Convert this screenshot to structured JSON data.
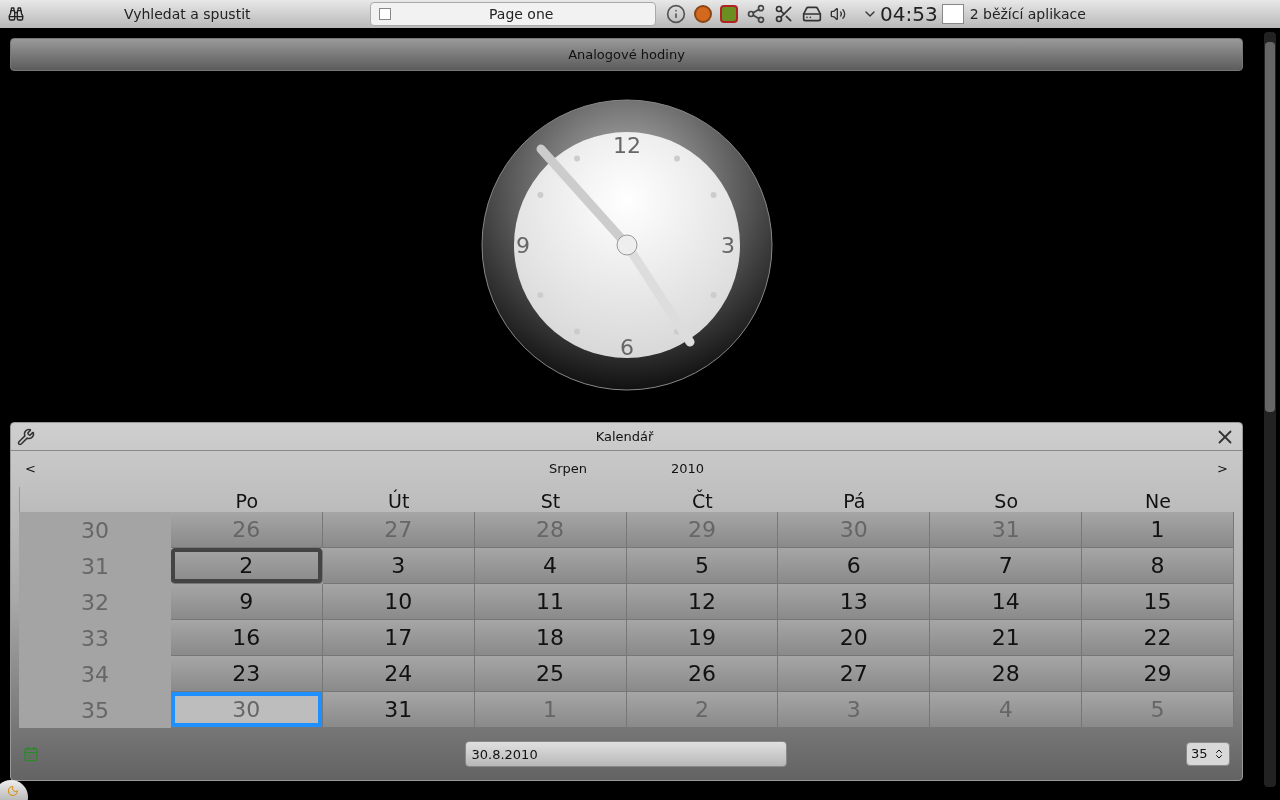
{
  "taskbar": {
    "launcher": "Vyhledat a spustit",
    "task": "Page one",
    "time": "04:53",
    "apps": "2 běžící aplikace"
  },
  "clock_widget": {
    "title": "Analogové hodiny",
    "numerals": [
      "12",
      "3",
      "6",
      "9"
    ]
  },
  "calendar": {
    "title": "Kalendář",
    "prev": "<",
    "next": ">",
    "month": "Srpen",
    "year": "2010",
    "weekdays": [
      "Po",
      "Út",
      "St",
      "Čt",
      "Pá",
      "So",
      "Ne"
    ],
    "weeks": [
      {
        "number": "30",
        "days": [
          {
            "label": "26",
            "outside": true,
            "today": false,
            "selected": false
          },
          {
            "label": "27",
            "outside": true,
            "today": false,
            "selected": false
          },
          {
            "label": "28",
            "outside": true,
            "today": false,
            "selected": false
          },
          {
            "label": "29",
            "outside": true,
            "today": false,
            "selected": false
          },
          {
            "label": "30",
            "outside": true,
            "today": false,
            "selected": false
          },
          {
            "label": "31",
            "outside": true,
            "today": false,
            "selected": false
          },
          {
            "label": "1",
            "outside": false,
            "today": false,
            "selected": false
          }
        ]
      },
      {
        "number": "31",
        "days": [
          {
            "label": "2",
            "outside": false,
            "today": true,
            "selected": false
          },
          {
            "label": "3",
            "outside": false,
            "today": false,
            "selected": false
          },
          {
            "label": "4",
            "outside": false,
            "today": false,
            "selected": false
          },
          {
            "label": "5",
            "outside": false,
            "today": false,
            "selected": false
          },
          {
            "label": "6",
            "outside": false,
            "today": false,
            "selected": false
          },
          {
            "label": "7",
            "outside": false,
            "today": false,
            "selected": false
          },
          {
            "label": "8",
            "outside": false,
            "today": false,
            "selected": false
          }
        ]
      },
      {
        "number": "32",
        "days": [
          {
            "label": "9",
            "outside": false,
            "today": false,
            "selected": false
          },
          {
            "label": "10",
            "outside": false,
            "today": false,
            "selected": false
          },
          {
            "label": "11",
            "outside": false,
            "today": false,
            "selected": false
          },
          {
            "label": "12",
            "outside": false,
            "today": false,
            "selected": false
          },
          {
            "label": "13",
            "outside": false,
            "today": false,
            "selected": false
          },
          {
            "label": "14",
            "outside": false,
            "today": false,
            "selected": false
          },
          {
            "label": "15",
            "outside": false,
            "today": false,
            "selected": false
          }
        ]
      },
      {
        "number": "33",
        "days": [
          {
            "label": "16",
            "outside": false,
            "today": false,
            "selected": false
          },
          {
            "label": "17",
            "outside": false,
            "today": false,
            "selected": false
          },
          {
            "label": "18",
            "outside": false,
            "today": false,
            "selected": false
          },
          {
            "label": "19",
            "outside": false,
            "today": false,
            "selected": false
          },
          {
            "label": "20",
            "outside": false,
            "today": false,
            "selected": false
          },
          {
            "label": "21",
            "outside": false,
            "today": false,
            "selected": false
          },
          {
            "label": "22",
            "outside": false,
            "today": false,
            "selected": false
          }
        ]
      },
      {
        "number": "34",
        "days": [
          {
            "label": "23",
            "outside": false,
            "today": false,
            "selected": false
          },
          {
            "label": "24",
            "outside": false,
            "today": false,
            "selected": false
          },
          {
            "label": "25",
            "outside": false,
            "today": false,
            "selected": false
          },
          {
            "label": "26",
            "outside": false,
            "today": false,
            "selected": false
          },
          {
            "label": "27",
            "outside": false,
            "today": false,
            "selected": false
          },
          {
            "label": "28",
            "outside": false,
            "today": false,
            "selected": false
          },
          {
            "label": "29",
            "outside": false,
            "today": false,
            "selected": false
          }
        ]
      },
      {
        "number": "35",
        "days": [
          {
            "label": "30",
            "outside": false,
            "today": false,
            "selected": true
          },
          {
            "label": "31",
            "outside": false,
            "today": false,
            "selected": false
          },
          {
            "label": "1",
            "outside": true,
            "today": false,
            "selected": false
          },
          {
            "label": "2",
            "outside": true,
            "today": false,
            "selected": false
          },
          {
            "label": "3",
            "outside": true,
            "today": false,
            "selected": false
          },
          {
            "label": "4",
            "outside": true,
            "today": false,
            "selected": false
          },
          {
            "label": "5",
            "outside": true,
            "today": false,
            "selected": false
          }
        ]
      }
    ],
    "date_field": "30.8.2010",
    "week_spin": "35"
  }
}
